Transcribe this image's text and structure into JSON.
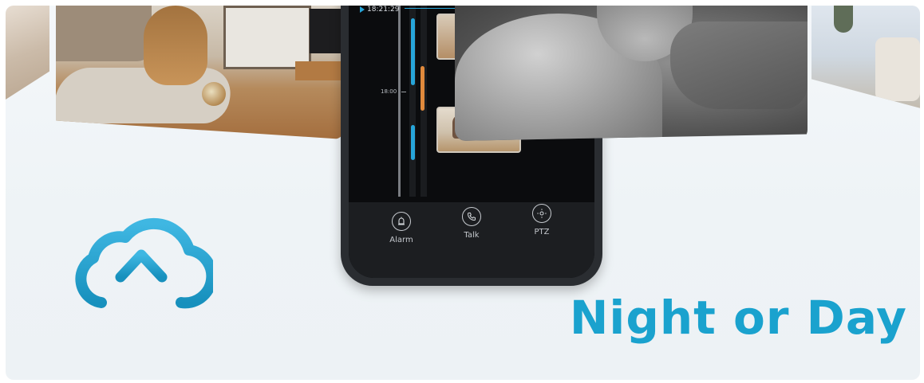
{
  "phone": {
    "timeline": {
      "current_time": "18:21:29",
      "tick_label": "18:00"
    },
    "actions": [
      {
        "label": "Alarm",
        "icon": "alarm-icon"
      },
      {
        "label": "Talk",
        "icon": "phone-icon"
      },
      {
        "label": "PTZ",
        "icon": "ptz-icon"
      }
    ]
  },
  "headline": "Night or Day",
  "icons": {
    "cloud": "cloud-upload-icon"
  },
  "colors": {
    "accent": "#1aa2ce",
    "timeline_blue": "#27a5d9",
    "timeline_orange": "#e08a3c"
  }
}
